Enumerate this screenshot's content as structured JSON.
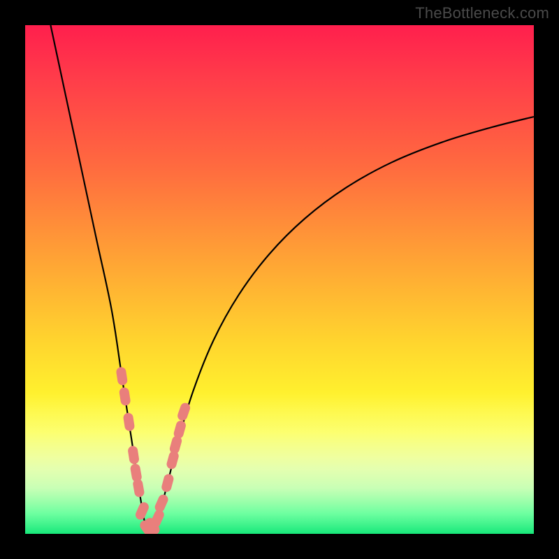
{
  "watermark": "TheBottleneck.com",
  "colors": {
    "frame": "#000000",
    "gradient_top": "#ff1f4d",
    "gradient_bottom": "#17e87a",
    "curve": "#000000",
    "marker": "#e97f7c",
    "watermark_text": "#4a4a4a"
  },
  "chart_data": {
    "type": "line",
    "title": "",
    "xlabel": "",
    "ylabel": "",
    "xlim": [
      0,
      100
    ],
    "ylim": [
      0,
      100
    ],
    "grid": false,
    "legend": false,
    "notes": "Single V-shaped bottleneck curve. x is relative horizontal position (0–100 left→right), y is bottleneck mismatch percentage (0 at bottom/green, 100 at top/red). Minimum near x≈24. Left arm rises steeply toward 100; right arm rises asymptotically toward ~82.",
    "series": [
      {
        "name": "bottleneck-curve",
        "x": [
          5,
          8,
          11,
          14,
          17,
          19,
          21,
          22.5,
          24,
          26,
          28,
          30,
          33,
          37,
          42,
          48,
          55,
          63,
          72,
          82,
          92,
          100
        ],
        "y": [
          100,
          86,
          72,
          58,
          44,
          31,
          18,
          8,
          1,
          3,
          10,
          18,
          28,
          38,
          47,
          55,
          62,
          68,
          73,
          77,
          80,
          82
        ]
      }
    ],
    "markers": {
      "name": "highlighted-points",
      "description": "Salmon lozenge markers clustered near the curve minimum on both arms.",
      "x": [
        19.0,
        19.6,
        20.4,
        21.3,
        21.8,
        22.3,
        23.0,
        24.0,
        25.0,
        26.0,
        26.8,
        28.0,
        29.0,
        29.6,
        30.4,
        31.2
      ],
      "y": [
        31.0,
        27.0,
        22.0,
        15.5,
        12.0,
        9.0,
        4.5,
        1.0,
        1.5,
        3.0,
        6.0,
        10.0,
        14.5,
        17.5,
        20.5,
        24.0
      ]
    }
  }
}
